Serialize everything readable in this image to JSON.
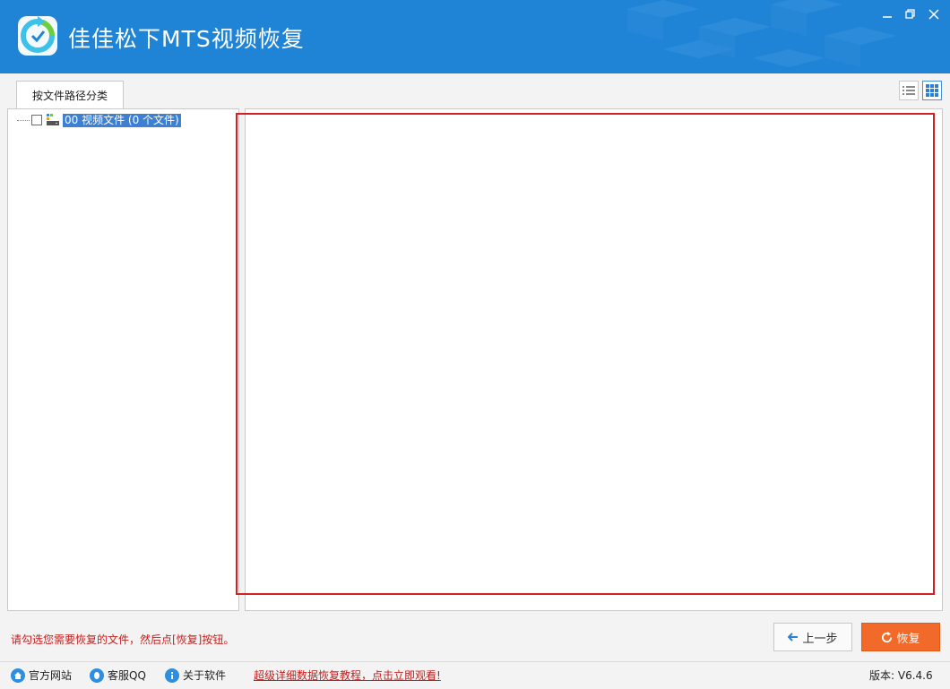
{
  "app": {
    "title": "佳佳松下MTS视频恢复",
    "accent_color": "#1f83d6"
  },
  "window_controls": {
    "minimize_icon": "minimize-icon",
    "restore_icon": "restore-icon",
    "close_icon": "close-icon"
  },
  "tabs": [
    {
      "label": "按文件路径分类"
    }
  ],
  "view_toggle": {
    "list_icon": "list-view-icon",
    "grid_icon": "grid-view-icon",
    "active": "grid"
  },
  "tree": {
    "items": [
      {
        "label": "00 视频文件 (0 个文件)",
        "checked": false,
        "icon": "drive-icon"
      }
    ]
  },
  "hint_text": "请勾选您需要恢复的文件，然后点[恢复]按钮。",
  "buttons": {
    "prev_label": "上一步",
    "recover_label": "恢复"
  },
  "footer": {
    "website_label": "官方网站",
    "qq_label": "客服QQ",
    "about_label": "关于软件",
    "tutorial_link": "超级详细数据恢复教程，点击立即观看!",
    "version": "版本: V6.4.6"
  }
}
